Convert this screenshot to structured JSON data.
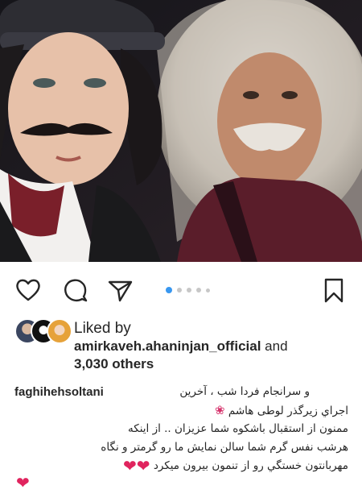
{
  "post": {
    "carousel": {
      "total_slides": 5,
      "active_slide": 1
    },
    "liked_by": {
      "prefix": "Liked by",
      "user": "amirkaveh.ahaninjan_official",
      "conjunction": "and",
      "others": "3,030 others"
    },
    "caption": {
      "username": "faghihehsoltani",
      "lines": [
        "و سرانجام فردا شب ، آخرین",
        "اجراي زيرگذر لوطى هاشم",
        "ممنون از استقبال باشکوه شما عزیزان .. از اینکه",
        "هرشب نفس گرم شما سالن نمایش ما رو گرمتر و نگاه",
        "مهربانتون خستگي رو از تنمون بیرون میکرد"
      ]
    },
    "icons": [
      "heart-icon",
      "comment-icon",
      "share-icon",
      "bookmark-icon",
      "flower-icon",
      "red-heart-icon"
    ],
    "colors": {
      "accent_dot": "#3897f0",
      "heart_emoji": "#e0245e",
      "text": "#262626"
    }
  }
}
